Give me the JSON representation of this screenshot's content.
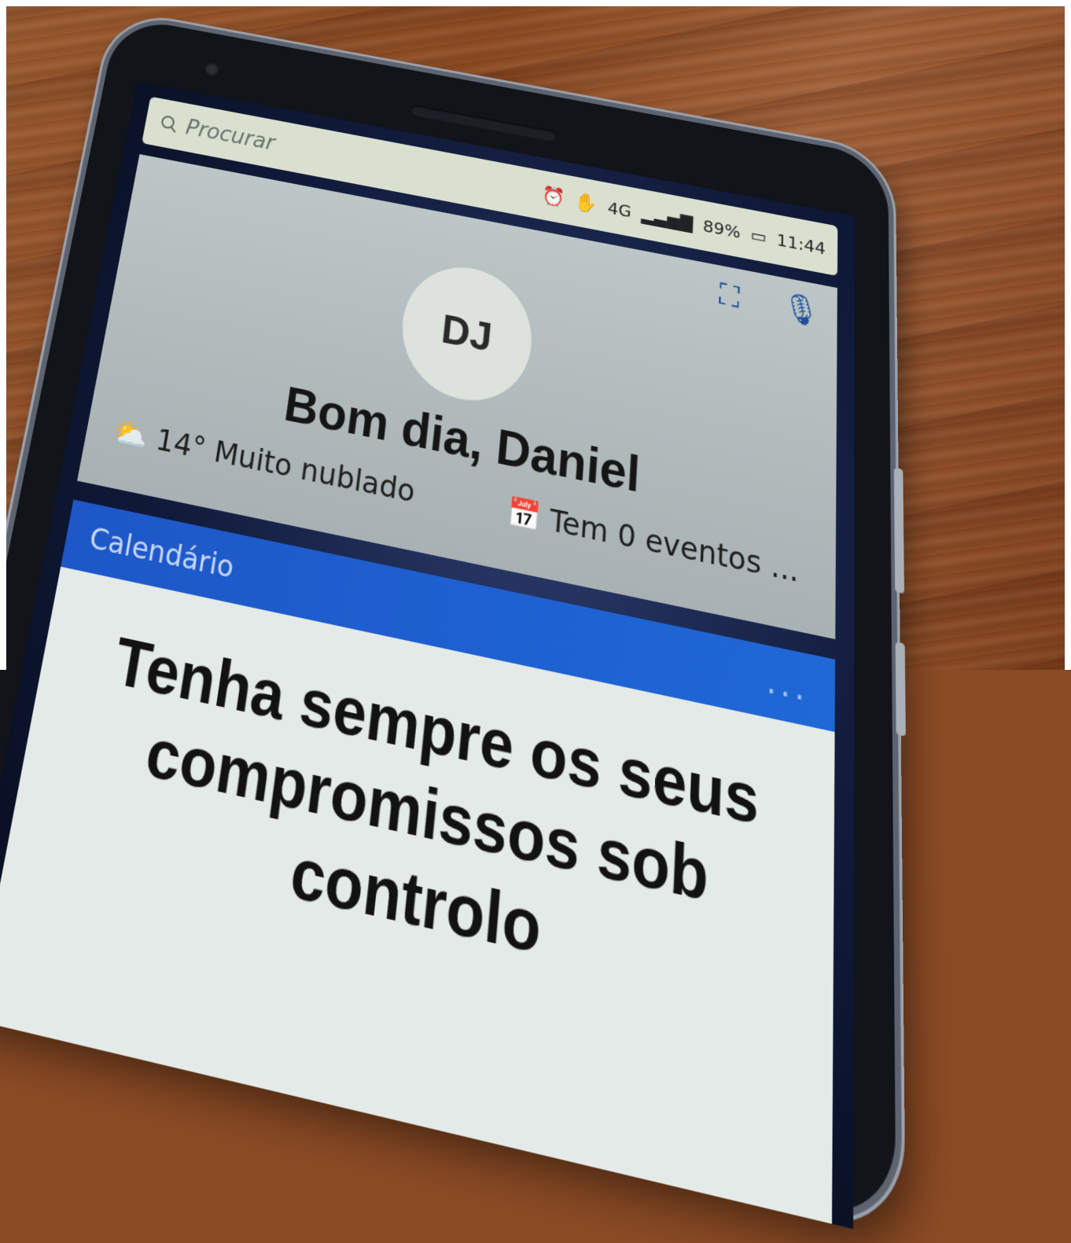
{
  "search": {
    "placeholder": "Procurar"
  },
  "status_bar": {
    "network": "4G",
    "battery": "89%",
    "time": "11:44"
  },
  "profile": {
    "initials": "DJ",
    "greeting": "Bom dia, Daniel",
    "weather": "14° Muito nublado",
    "events": "Tem 0 eventos ..."
  },
  "calendar_card": {
    "title": "Calendário",
    "more": "...",
    "message": "Tenha sempre os seus compromissos sob controlo"
  },
  "colors": {
    "accent_blue": "#1f68d6",
    "icon_blue": "#1a6bd0"
  },
  "icons": {
    "search": "search-icon",
    "alarm": "alarm-icon",
    "scan": "scan-icon",
    "mic": "microphone-icon",
    "weather": "partly-cloudy-icon",
    "calendar": "calendar-icon"
  }
}
